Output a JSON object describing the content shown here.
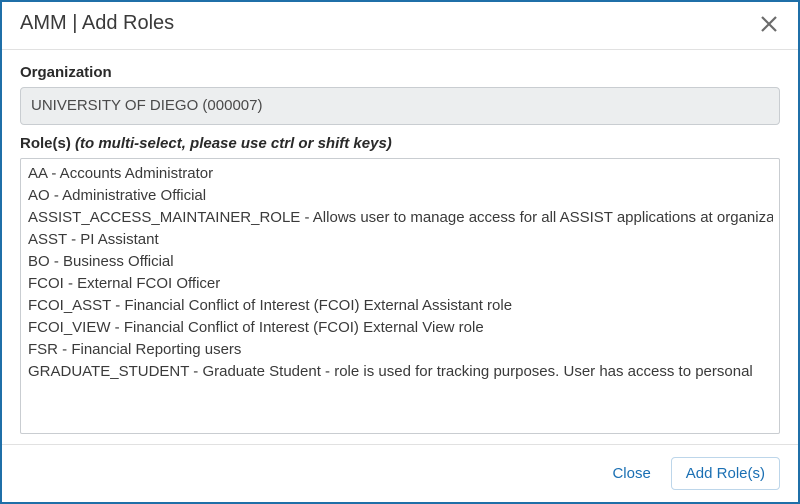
{
  "header": {
    "title": "AMM | Add Roles"
  },
  "org": {
    "label": "Organization",
    "value": "UNIVERSITY OF  DIEGO (000007)"
  },
  "roles": {
    "label_prefix": "Role(s) ",
    "label_hint": "(to multi-select, please use ctrl or shift keys)",
    "items": [
      "AA - Accounts Administrator",
      "AO - Administrative Official",
      "ASSIST_ACCESS_MAINTAINER_ROLE - Allows user to manage access for all ASSIST applications at organization",
      "ASST - PI Assistant",
      "BO - Business Official",
      "FCOI - External FCOI Officer",
      "FCOI_ASST - Financial Conflict of Interest (FCOI) External Assistant role",
      "FCOI_VIEW - Financial Conflict of Interest (FCOI) External View role",
      "FSR - Financial Reporting users",
      "GRADUATE_STUDENT - Graduate Student - role is used for tracking purposes. User has access to personal"
    ]
  },
  "footer": {
    "close_label": "Close",
    "add_label": "Add Role(s)"
  }
}
